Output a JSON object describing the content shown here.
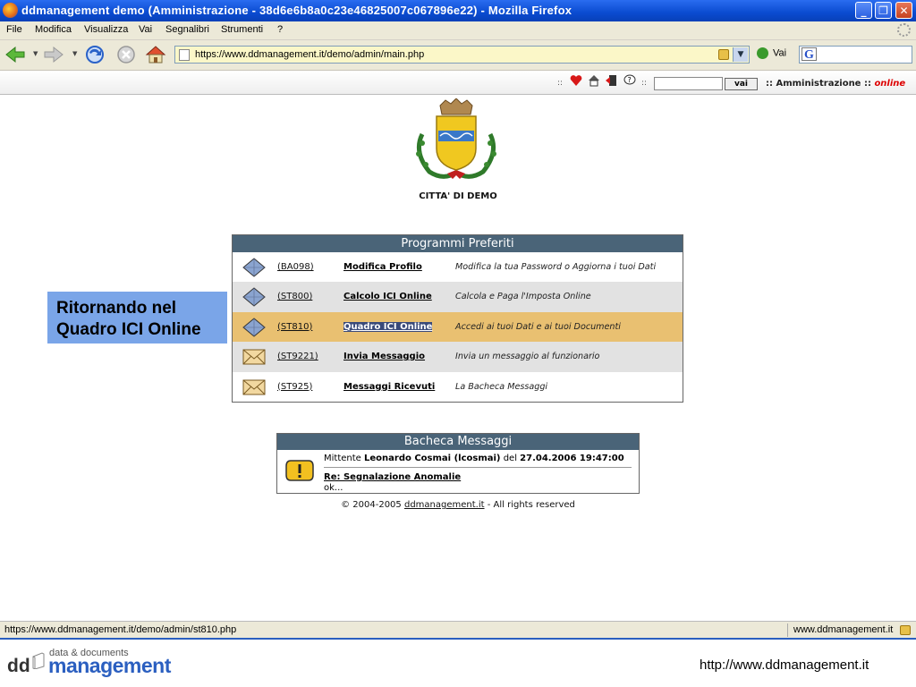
{
  "window": {
    "title": "ddmanagement demo (Amministrazione - 38d6e6b8a0c23e46825007c067896e22) - Mozilla Firefox",
    "controls": [
      "minimize",
      "restore",
      "close"
    ]
  },
  "menubar": {
    "items": [
      "File",
      "Modifica",
      "Visualizza",
      "Vai",
      "Segnalibri",
      "Strumenti",
      "?"
    ]
  },
  "navbar": {
    "url": "https://www.ddmanagement.it/demo/admin/main.php",
    "go_label": "Vai",
    "icons": [
      "back-icon",
      "forward-icon",
      "reload-icon",
      "stop-icon",
      "home-icon"
    ]
  },
  "pagebar": {
    "sep": "::",
    "icons": [
      "heart-icon",
      "home-icon",
      "exit-icon",
      "help-icon"
    ],
    "search_value": "",
    "search_button": "vai",
    "admin_label": ":: Amministrazione ::",
    "status_label": "online"
  },
  "crest": {
    "city_name": "CITTA' DI DEMO"
  },
  "favorites": {
    "title": "Programmi Preferiti",
    "rows": [
      {
        "code": "(BA098)",
        "name": "Modifica Profilo",
        "desc": "Modifica la tua Password o Aggiorna i tuoi Dati",
        "icon": "diamond-icon"
      },
      {
        "code": "(ST800)",
        "name": "Calcolo ICI Online",
        "desc": "Calcola e Paga l'Imposta Online",
        "icon": "diamond-icon"
      },
      {
        "code": "(ST810)",
        "name": "Quadro ICI Online",
        "desc": "Accedi ai tuoi Dati e ai tuoi Documenti",
        "icon": "diamond-icon"
      },
      {
        "code": "(ST9221)",
        "name": "Invia Messaggio",
        "desc": "Invia un messaggio al funzionario",
        "icon": "envelope-icon"
      },
      {
        "code": "(ST925)",
        "name": "Messaggi Ricevuti",
        "desc": "La Bacheca Messaggi",
        "icon": "envelope-icon"
      }
    ]
  },
  "callout": {
    "line1": "Ritornando nel",
    "line2": "Quadro ICI Online"
  },
  "messages": {
    "title": "Bacheca Messaggi",
    "sender_prefix": "Mittente",
    "sender": "Leonardo Cosmai (lcosmai)",
    "date_prefix": "del",
    "date": "27.04.2006 19:47:00",
    "subject": "Re: Segnalazione Anomalie",
    "body": "ok..."
  },
  "copyright": {
    "prefix": "© 2004-2005",
    "link": "ddmanagement.it",
    "suffix": "- All rights reserved"
  },
  "statusbar": {
    "url": "https://www.ddmanagement.it/demo/admin/st810.php",
    "domain": "www.ddmanagement.it"
  },
  "footer": {
    "logo_dd": "dd",
    "logo_small": "data & documents",
    "logo_big": "management",
    "url": "http://www.ddmanagement.it"
  }
}
